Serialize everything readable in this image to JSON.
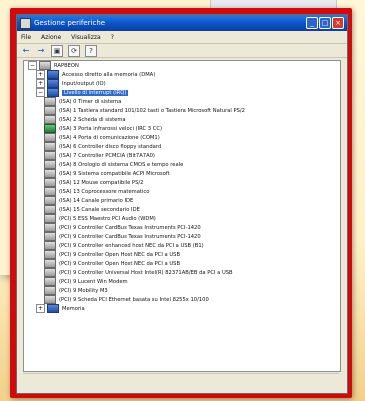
{
  "window": {
    "title": "Gestione periferiche",
    "controls": {
      "minimize": "_",
      "maximize": "□",
      "close": "×"
    }
  },
  "menu": [
    "File",
    "Azione",
    "Visualizza",
    "?"
  ],
  "toolbar": {
    "back": "←",
    "forward": "→",
    "t1": "▣",
    "t2": "⟳",
    "t3": "?"
  },
  "tree": {
    "root": "RAPBEON",
    "items": [
      {
        "label": "Accesso diretto alla memoria (DMA)",
        "expanded": false
      },
      {
        "label": "Input/output (IO)",
        "expanded": false
      },
      {
        "label": "Livello di interrupt (IRQ)",
        "expanded": true
      }
    ],
    "irq_children": [
      "(ISA) 0  Timer di sistema",
      "(ISA) 1  Tastiera standard 101/102 tasti o Tastiera Microsoft Natural PS/2",
      "(ISA) 2  Scheda di sistema",
      "(ISA) 3  Porta infrarossi veloci (IRC 3 CC)",
      "(ISA) 4  Porta di comunicazione (COM1)",
      "(ISA) 6  Controller disco floppy standard",
      "(ISA) 7  Controller PCMCIA (Bit7A7A0)",
      "(ISA) 8  Orologio di sistema CMOS e tempo reale",
      "(ISA) 9  Sistema compatibile ACPI Microsoft",
      "(ISA) 12 Mouse compatibile PS/2",
      "(ISA) 13 Coprocessore matematico",
      "(ISA) 14 Canale primario IDE",
      "(ISA) 15 Canale secondario IDE",
      "(PCI) 5  ESS Maestro PCI Audio (WDM)",
      "(PCI) 9  Controller CardBus Texas Instruments PCI-1420",
      "(PCI) 9  Controller CardBus Texas Instruments PCI-1420",
      "(PCI) 9  Controller enhanced host NEC da PCI a USB (B1)",
      "(PCI) 9  Controller Open Host NEC da PCI a USB",
      "(PCI) 9  Controller Open Host NEC da PCI a USB",
      "(PCI) 9  Controller Universal Host Intel(R) 82371AB/EB da PCI a USB",
      "(PCI) 9  Lucent Win Modem",
      "(PCI) 9  Mobility M3",
      "(PCI) 9  Scheda PCI Ethernet basata su Intel 8255x 10/100"
    ],
    "last": "Memoria"
  }
}
